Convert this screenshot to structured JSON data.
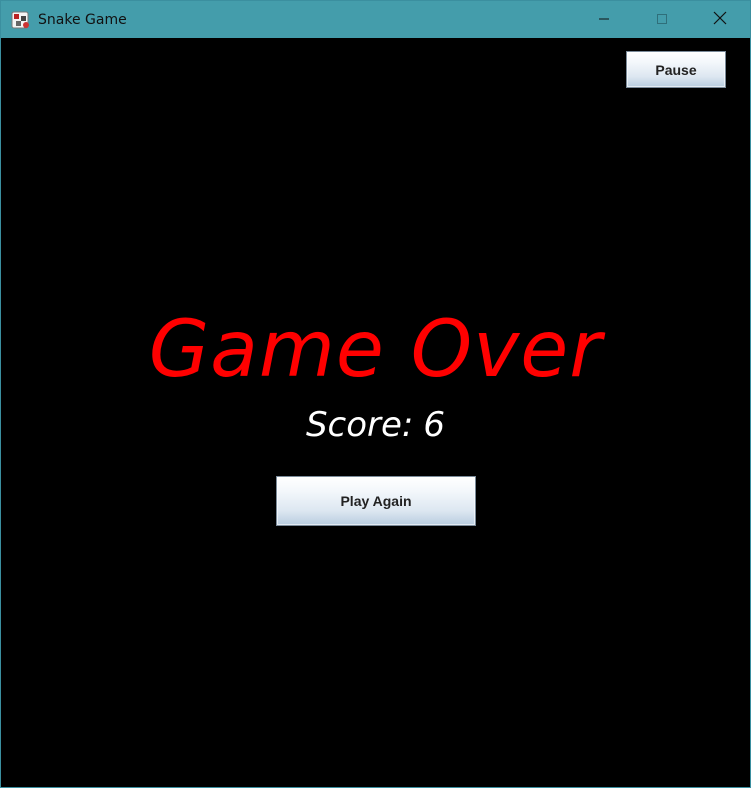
{
  "window": {
    "title": "Snake Game",
    "titlebar_color": "#449dab",
    "icons": {
      "app": "snake-app-icon",
      "minimize": "minimize-icon",
      "maximize": "maximize-icon",
      "close": "close-icon"
    }
  },
  "game": {
    "background": "#000000",
    "pause_label": "Pause",
    "game_over_text": "Game Over",
    "game_over_color": "#ff0000",
    "score_label": "Score:",
    "score_value": "6",
    "score_color": "#ffffff",
    "play_again_label": "Play Again"
  }
}
